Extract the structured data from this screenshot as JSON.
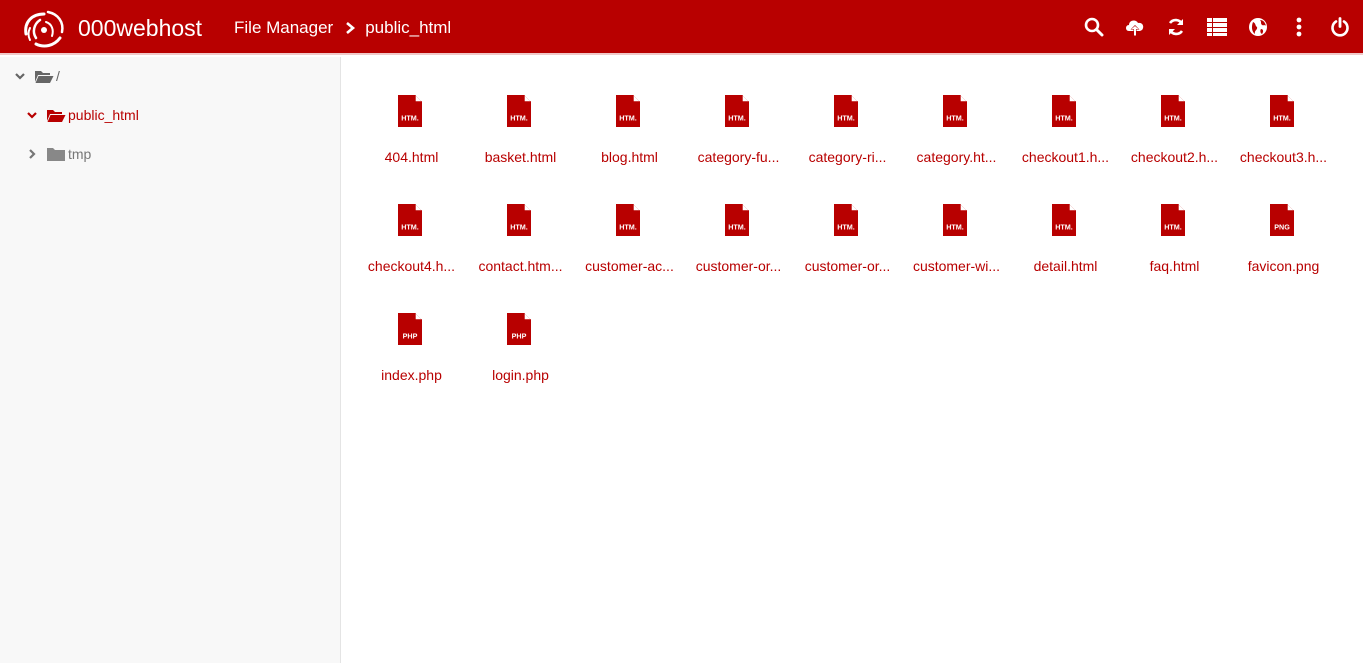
{
  "app": {
    "brand": "000webhost",
    "accent_color": "#b80000"
  },
  "breadcrumb": {
    "root": "File Manager",
    "current": "public_html"
  },
  "toolbar": {
    "icons": [
      "search-icon",
      "upload-icon",
      "refresh-icon",
      "list-view-icon",
      "globe-icon",
      "more-icon",
      "power-icon"
    ]
  },
  "tree": {
    "root": "/",
    "items": [
      {
        "label": "public_html",
        "expanded": true,
        "active": true
      },
      {
        "label": "tmp",
        "expanded": false,
        "active": false
      }
    ]
  },
  "files": [
    {
      "name": "404.html",
      "type": "HTM."
    },
    {
      "name": "basket.html",
      "type": "HTM."
    },
    {
      "name": "blog.html",
      "type": "HTM."
    },
    {
      "name": "category-fu...",
      "type": "HTM."
    },
    {
      "name": "category-ri...",
      "type": "HTM."
    },
    {
      "name": "category.ht...",
      "type": "HTM."
    },
    {
      "name": "checkout1.h...",
      "type": "HTM."
    },
    {
      "name": "checkout2.h...",
      "type": "HTM."
    },
    {
      "name": "checkout3.h...",
      "type": "HTM."
    },
    {
      "name": "checkout4.h...",
      "type": "HTM."
    },
    {
      "name": "contact.htm...",
      "type": "HTM."
    },
    {
      "name": "customer-ac...",
      "type": "HTM."
    },
    {
      "name": "customer-or...",
      "type": "HTM."
    },
    {
      "name": "customer-or...",
      "type": "HTM."
    },
    {
      "name": "customer-wi...",
      "type": "HTM."
    },
    {
      "name": "detail.html",
      "type": "HTM."
    },
    {
      "name": "faq.html",
      "type": "HTM."
    },
    {
      "name": "favicon.png",
      "type": "PNG"
    },
    {
      "name": "index.php",
      "type": "PHP"
    },
    {
      "name": "login.php",
      "type": "PHP"
    }
  ]
}
